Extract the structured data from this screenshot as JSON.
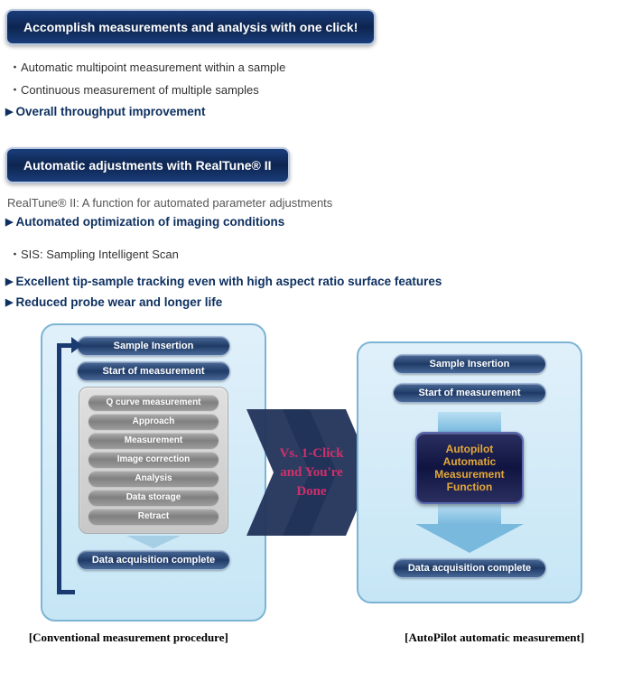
{
  "section1": {
    "badge": "Accomplish measurements and analysis with one click!",
    "bullets": [
      "Automatic multipoint measurement within a sample",
      "Continuous measurement of multiple samples"
    ],
    "arrow": "Overall throughput improvement"
  },
  "section2": {
    "badge": "Automatic adjustments with RealTune® II",
    "intro": "RealTune® II: A function for automated parameter adjustments",
    "arrow1": "Automated optimization of imaging conditions",
    "sis": "SIS: Sampling Intelligent Scan",
    "arrow2": "Excellent tip-sample tracking even with high aspect ratio surface features",
    "arrow3": "Reduced probe wear and longer life"
  },
  "diagram": {
    "left": {
      "top1": "Sample Insertion",
      "top2": "Start of measurement",
      "steps": [
        "Q curve measurement",
        "Approach",
        "Measurement",
        "Image correction",
        "Analysis",
        "Data storage",
        "Retract"
      ],
      "bottom": "Data acquisition complete",
      "caption": "[Conventional measurement procedure]"
    },
    "vs": {
      "line1": "Vs. 1-Click",
      "line2": "and You're",
      "line3": "Done"
    },
    "right": {
      "top1": "Sample Insertion",
      "top2": "Start of measurement",
      "feature1": "Autopilot Automatic",
      "feature2": "Measurement Function",
      "bottom": "Data acquisition complete",
      "caption": "[AutoPilot automatic measurement]"
    }
  }
}
